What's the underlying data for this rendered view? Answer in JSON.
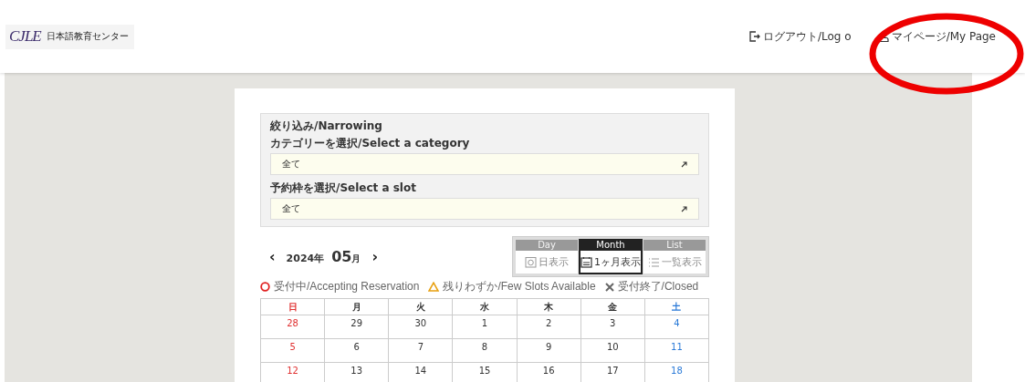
{
  "header": {
    "logo": {
      "mark": "CJLE",
      "name": "日本語教育センター"
    },
    "links": [
      {
        "label": "ログアウト/Log o",
        "kind": "logout"
      },
      {
        "label": "マイページ/My Page",
        "kind": "mypage"
      }
    ],
    "annotation_circle": true
  },
  "filter": {
    "title": "絞り込み/Narrowing",
    "fields": [
      {
        "label": "カテゴリーを選択/Select a category",
        "value": "全て"
      },
      {
        "label": "予約枠を選択/Select a slot",
        "value": "全て"
      }
    ]
  },
  "calendar": {
    "year": "2024年",
    "month": "05",
    "month_unit": "月",
    "prev": "‹",
    "next": "›",
    "legend": [
      {
        "kind": "open",
        "label": "受付中/Accepting Reservation"
      },
      {
        "kind": "few",
        "label": "残りわずか/Few Slots Available"
      },
      {
        "kind": "closed",
        "label": "受付終了/Closed"
      }
    ],
    "views": [
      {
        "kind": "day",
        "tab": "Day",
        "label": "日表示",
        "selected": false
      },
      {
        "kind": "month",
        "tab": "Month",
        "label": "1ヶ月表示",
        "selected": true
      },
      {
        "kind": "list",
        "tab": "List",
        "label": "一覧表示",
        "selected": false
      }
    ],
    "weekdays": [
      "日",
      "月",
      "火",
      "水",
      "木",
      "金",
      "土"
    ],
    "weeks": [
      [
        "28",
        "29",
        "30",
        "1",
        "2",
        "3",
        "4"
      ],
      [
        "5",
        "6",
        "7",
        "8",
        "9",
        "10",
        "11"
      ],
      [
        "12",
        "13",
        "14",
        "15",
        "16",
        "17",
        "18"
      ]
    ]
  }
}
